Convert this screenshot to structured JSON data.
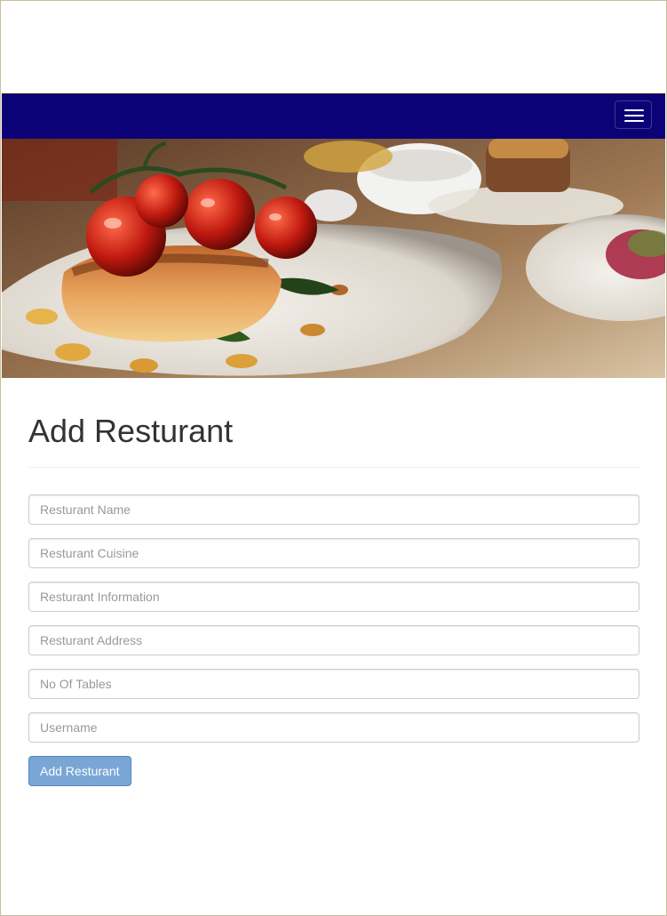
{
  "navbar": {
    "background_color": "#0c0277",
    "toggle_icon": "hamburger-icon"
  },
  "hero": {
    "image": "restaurant-food-photo"
  },
  "page": {
    "title": "Add Resturant"
  },
  "form": {
    "fields": [
      {
        "name": "restaurant-name",
        "placeholder": "Resturant Name",
        "value": ""
      },
      {
        "name": "restaurant-cuisine",
        "placeholder": "Resturant Cuisine",
        "value": ""
      },
      {
        "name": "restaurant-information",
        "placeholder": "Resturant Information",
        "value": ""
      },
      {
        "name": "restaurant-address",
        "placeholder": "Resturant Address",
        "value": ""
      },
      {
        "name": "no-of-tables",
        "placeholder": "No Of Tables",
        "value": ""
      },
      {
        "name": "username",
        "placeholder": "Username",
        "value": ""
      }
    ],
    "submit_label": "Add Resturant",
    "submit_color": "#7aa6d6"
  }
}
